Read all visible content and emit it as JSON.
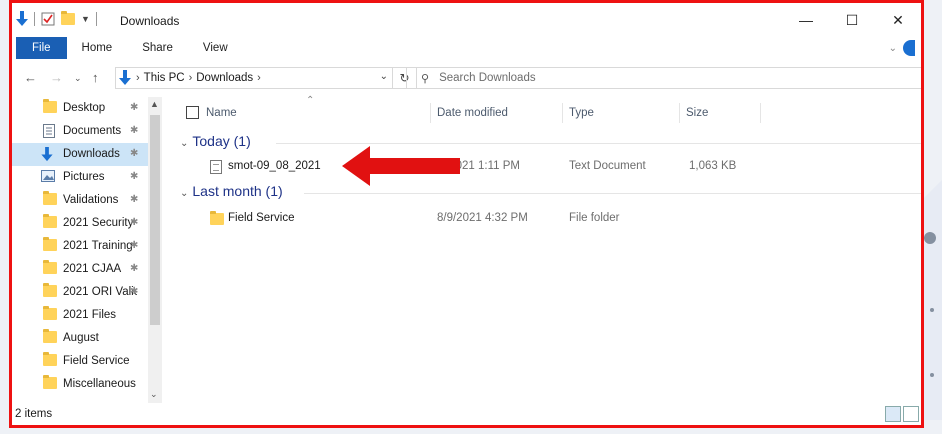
{
  "window": {
    "title": "Downloads"
  },
  "ribbon": {
    "tabs": [
      "File",
      "Home",
      "Share",
      "View"
    ]
  },
  "address": {
    "crumbs": [
      "This PC",
      "Downloads"
    ]
  },
  "search": {
    "placeholder": "Search Downloads"
  },
  "nav_pane": {
    "items": [
      {
        "label": "Desktop",
        "icon": "folder-icon",
        "pinned": true
      },
      {
        "label": "Documents",
        "icon": "document-icon",
        "pinned": true
      },
      {
        "label": "Downloads",
        "icon": "download-icon",
        "pinned": true,
        "selected": true
      },
      {
        "label": "Pictures",
        "icon": "pictures-icon",
        "pinned": true
      },
      {
        "label": "Validations",
        "icon": "folder-icon",
        "pinned": true
      },
      {
        "label": "2021 Security",
        "icon": "folder-icon",
        "pinned": true
      },
      {
        "label": "2021 Training",
        "icon": "folder-icon",
        "pinned": true
      },
      {
        "label": "2021 CJAA",
        "icon": "folder-icon",
        "pinned": true
      },
      {
        "label": "2021 ORI Valic",
        "icon": "folder-icon",
        "pinned": true
      },
      {
        "label": "2021 Files",
        "icon": "folder-icon",
        "pinned": false
      },
      {
        "label": "August",
        "icon": "folder-icon",
        "pinned": false
      },
      {
        "label": "Field Service",
        "icon": "folder-icon",
        "pinned": false
      },
      {
        "label": "Miscellaneous",
        "icon": "folder-icon",
        "pinned": false
      }
    ]
  },
  "columns": {
    "name": "Name",
    "date": "Date modified",
    "type": "Type",
    "size": "Size"
  },
  "groups": [
    {
      "label": "Today (1)",
      "rows": [
        {
          "name": "smot-09_08_2021",
          "date": "/2021 1:11 PM",
          "type": "Text Document",
          "size": "1,063 KB",
          "icon": "text-file-icon"
        }
      ]
    },
    {
      "label": "Last month (1)",
      "rows": [
        {
          "name": "Field Service",
          "date": "8/9/2021 4:32 PM",
          "type": "File folder",
          "size": "",
          "icon": "folder-icon"
        }
      ]
    }
  ],
  "status": {
    "items_count": "2 items"
  },
  "colors": {
    "annotation": "#e11111",
    "selection": "#cce4f7",
    "file_tab": "#1a5fb4"
  }
}
